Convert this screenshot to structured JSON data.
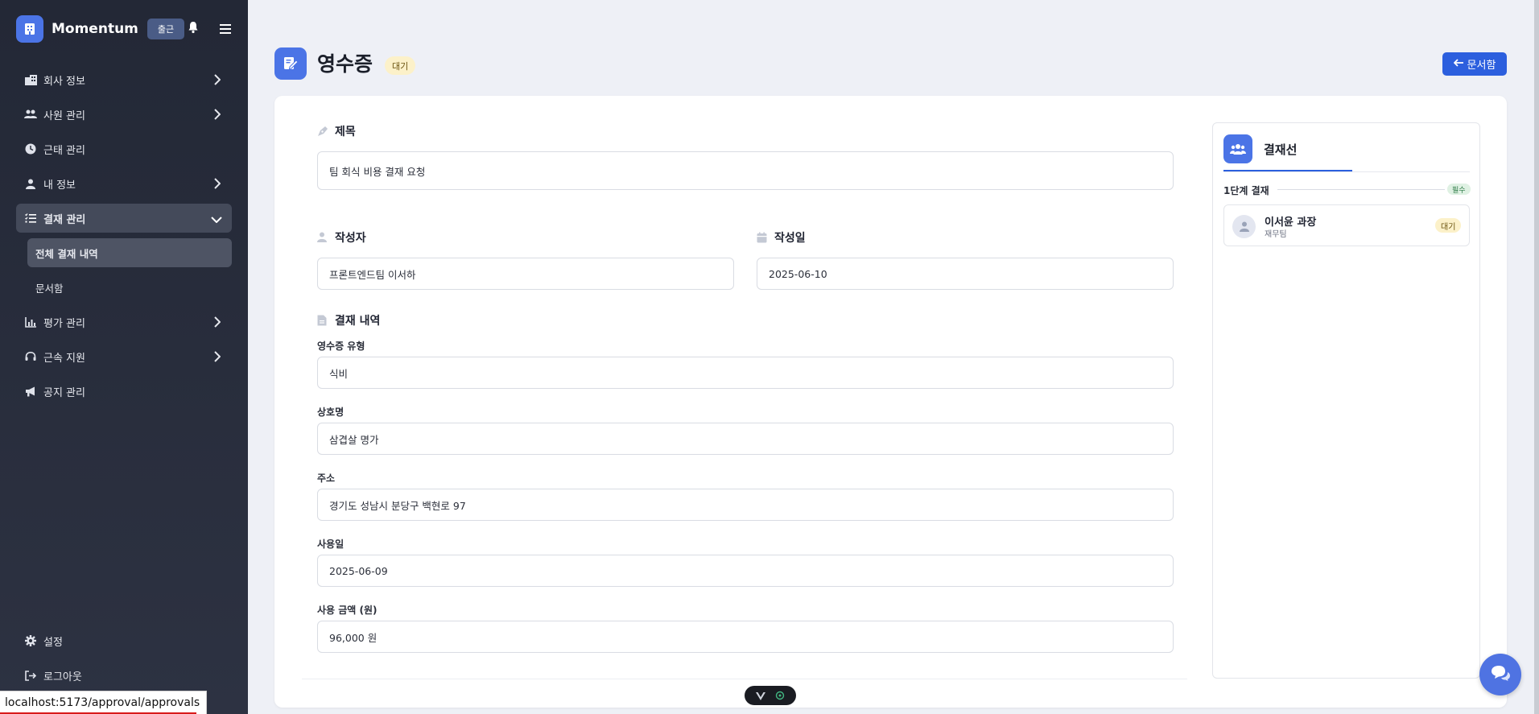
{
  "app": {
    "name": "Momentum",
    "checkin_label": "출근"
  },
  "sidebar": {
    "items": [
      {
        "label": "회사 정보",
        "icon": "building-icon"
      },
      {
        "label": "사원 관리",
        "icon": "users-icon"
      },
      {
        "label": "근태 관리",
        "icon": "clock-icon"
      },
      {
        "label": "내 정보",
        "icon": "user-icon"
      },
      {
        "label": "결재 관리",
        "icon": "list-check-icon"
      },
      {
        "label": "평가 관리",
        "icon": "chart-icon"
      },
      {
        "label": "근속 지원",
        "icon": "headset-icon"
      },
      {
        "label": "공지 관리",
        "icon": "megaphone-icon"
      }
    ],
    "sub_items": [
      {
        "label": "전체 결재 내역"
      },
      {
        "label": "문서함"
      }
    ],
    "bottom": [
      {
        "label": "설정",
        "icon": "gear-icon"
      },
      {
        "label": "로그아웃",
        "icon": "logout-icon"
      }
    ]
  },
  "status_bar": {
    "url": "localhost:5173/approval/approvals"
  },
  "header": {
    "title": "영수증",
    "status": "대기",
    "inbox_button": "문서함"
  },
  "form": {
    "title_label": "제목",
    "title_value": "팀 회식 비용 결재 요청",
    "author_label": "작성자",
    "author_value": "프론트엔드팀 이서하",
    "date_label": "작성일",
    "date_value": "2025-06-10",
    "details_label": "결재 내역",
    "fields": [
      {
        "label": "영수증 유형",
        "value": "식비"
      },
      {
        "label": "상호명",
        "value": "삼겹살 명가"
      },
      {
        "label": "주소",
        "value": "경기도 성남시 분당구 백현로 97"
      },
      {
        "label": "사용일",
        "value": "2025-06-09"
      },
      {
        "label": "사용 금액 (원)",
        "value": "96,000 원"
      }
    ]
  },
  "approval_line": {
    "title": "결재선",
    "stage_label": "1단계 결재",
    "required_badge": "필수",
    "approver_name": "이서윤 과장",
    "approver_team": "재무팀",
    "approver_status": "대기"
  },
  "colors": {
    "accent": "#2c5fde",
    "sidebar_bg": "#232836",
    "pending_bg": "#fcf1c9"
  }
}
